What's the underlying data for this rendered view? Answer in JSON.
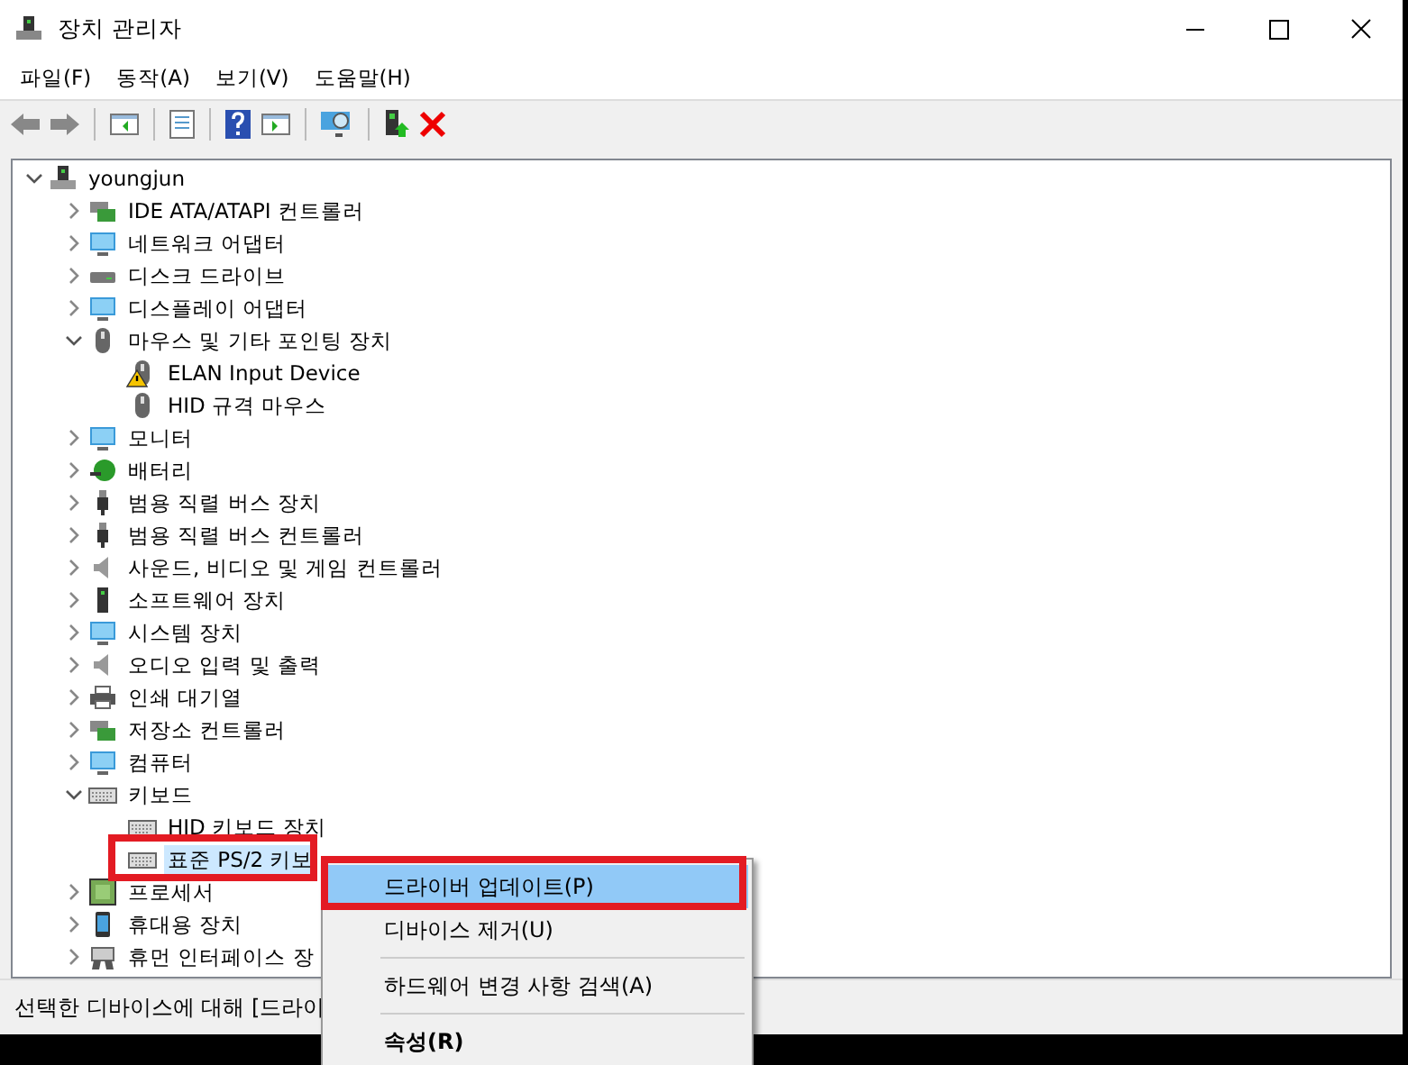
{
  "window": {
    "title": "장치 관리자"
  },
  "menu_bar": [
    "파일(F)",
    "동작(A)",
    "보기(V)",
    "도움말(H)"
  ],
  "tree": {
    "label": "youngjun",
    "expanded": true,
    "selected": false,
    "children": [
      {
        "label": "IDE ATA/ATAPI 컨트롤러",
        "expanded": false,
        "selected": false
      },
      {
        "label": "네트워크 어댑터",
        "expanded": false,
        "selected": false
      },
      {
        "label": "디스크 드라이브",
        "expanded": false,
        "selected": false
      },
      {
        "label": "디스플레이 어댑터",
        "expanded": false,
        "selected": false
      },
      {
        "label": "마우스 및 기타 포인팅 장치",
        "expanded": true,
        "selected": false,
        "children": [
          {
            "label": "ELAN Input Device",
            "warning": true,
            "selected": false
          },
          {
            "label": "HID 규격 마우스",
            "warning": false,
            "selected": false
          }
        ]
      },
      {
        "label": "모니터",
        "expanded": false,
        "selected": false
      },
      {
        "label": "배터리",
        "expanded": false,
        "selected": false
      },
      {
        "label": "범용 직렬 버스 장치",
        "expanded": false,
        "selected": false
      },
      {
        "label": "범용 직렬 버스 컨트롤러",
        "expanded": false,
        "selected": false
      },
      {
        "label": "사운드, 비디오 및 게임 컨트롤러",
        "expanded": false,
        "selected": false
      },
      {
        "label": "소프트웨어 장치",
        "expanded": false,
        "selected": false
      },
      {
        "label": "시스템 장치",
        "expanded": false,
        "selected": false
      },
      {
        "label": "오디오 입력 및 출력",
        "expanded": false,
        "selected": false
      },
      {
        "label": "인쇄 대기열",
        "expanded": false,
        "selected": false
      },
      {
        "label": "저장소 컨트롤러",
        "expanded": false,
        "selected": false
      },
      {
        "label": "컴퓨터",
        "expanded": false,
        "selected": false
      },
      {
        "label": "키보드",
        "expanded": true,
        "selected": false,
        "children": [
          {
            "label": "HID 키보드 장치",
            "warning": false,
            "selected": false
          },
          {
            "label": "표준 PS/2 키보",
            "warning": false,
            "selected": true
          }
        ]
      },
      {
        "label": "프로세서",
        "expanded": false,
        "selected": false
      },
      {
        "label": "휴대용 장치",
        "expanded": false,
        "selected": false
      },
      {
        "label": "휴먼 인터페이스 장",
        "expanded": false,
        "selected": false
      }
    ]
  },
  "status_bar": "선택한 디바이스에 대해 [드라이",
  "context_menu": [
    {
      "kind": "item",
      "label": "드라이버 업데이트(P)",
      "selected": true,
      "default": false
    },
    {
      "kind": "item",
      "label": "디바이스 제거(U)",
      "selected": false,
      "default": false
    },
    {
      "kind": "separator"
    },
    {
      "kind": "item",
      "label": "하드웨어 변경 사항 검색(A)",
      "selected": false,
      "default": false
    },
    {
      "kind": "separator"
    },
    {
      "kind": "item",
      "label": "속성(R)",
      "selected": false,
      "default": true
    }
  ]
}
